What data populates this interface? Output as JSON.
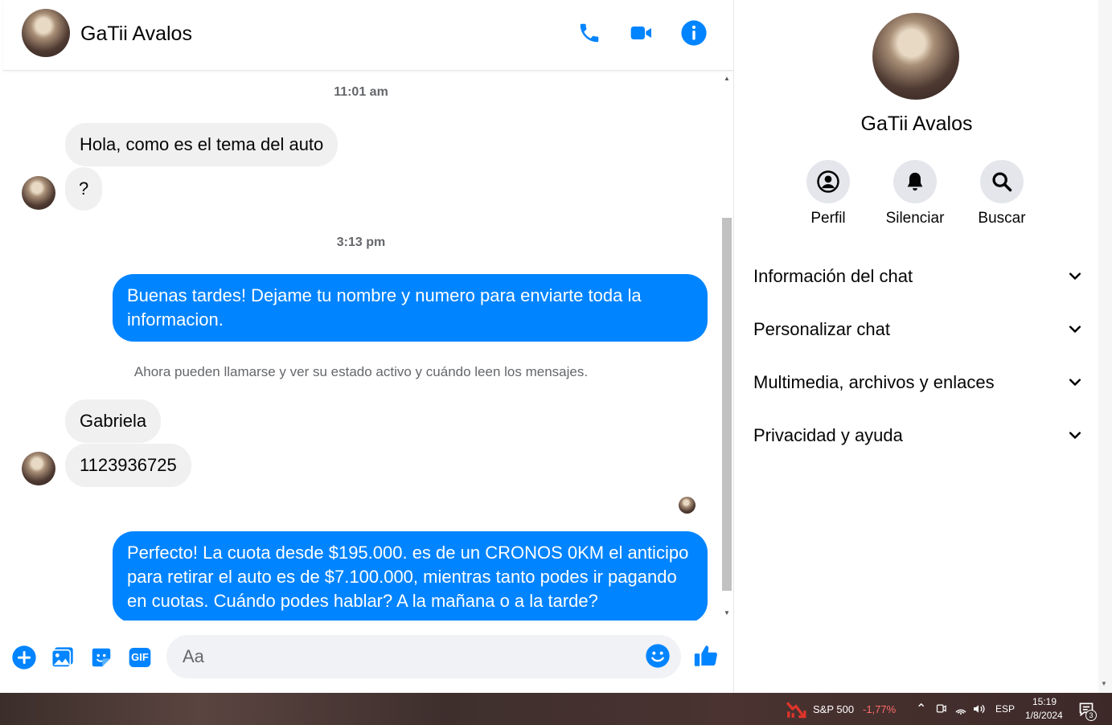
{
  "contact": {
    "name": "GaTii Avalos"
  },
  "header": {
    "call_icon": "phone-icon",
    "video_icon": "video-camera-icon",
    "info_icon": "info-icon"
  },
  "messages": {
    "timestamp_1": "11:01 am",
    "in_1": "Hola, como es el tema del auto",
    "in_2": "?",
    "timestamp_2": "3:13 pm",
    "out_1": "Buenas tardes! Dejame tu nombre y  numero para enviarte toda la informacion.",
    "system_note": "Ahora pueden llamarse y ver su estado activo y cuándo leen los mensajes.",
    "in_3": "Gabriela",
    "in_4": "1123936725",
    "out_2": "Perfecto! La cuota desde $195.000. es de un CRONOS 0KM el anticipo para retirar el auto es de $7.100.000, mientras tanto podes ir pagando en cuotas. Cuándo podes hablar? A la mañana o a la tarde?"
  },
  "composer": {
    "placeholder": "Aa",
    "icons": [
      "plus-icon",
      "image-icon",
      "sticker-icon",
      "gif-icon",
      "emoji-icon",
      "thumbs-up-icon"
    ],
    "gif_label": "GIF"
  },
  "side_panel": {
    "name": "GaTii Avalos",
    "actions": [
      {
        "label": "Perfil",
        "icon": "profile-icon"
      },
      {
        "label": "Silenciar",
        "icon": "bell-icon"
      },
      {
        "label": "Buscar",
        "icon": "search-icon"
      }
    ],
    "sections": [
      {
        "label": "Información del chat"
      },
      {
        "label": "Personalizar chat"
      },
      {
        "label": "Multimedia, archivos y enlaces"
      },
      {
        "label": "Privacidad y ayuda"
      }
    ]
  },
  "taskbar": {
    "ticker_name": "S&P 500",
    "ticker_change": "-1,77%",
    "language": "ESP",
    "time": "15:19",
    "date": "1/8/2024",
    "notification_count": "3"
  },
  "colors": {
    "brand_blue": "#0084ff",
    "incoming_bubble": "#f0f0f0",
    "negative_ticker": "#ff6b6b"
  }
}
